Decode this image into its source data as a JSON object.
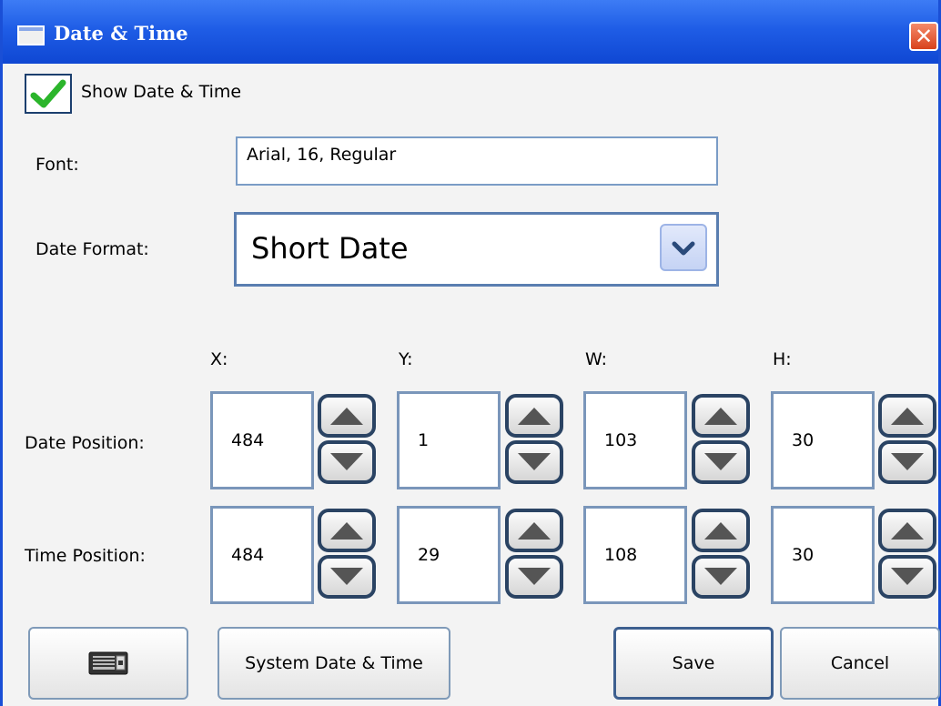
{
  "window": {
    "title": "Date & Time",
    "close_glyph": "✕"
  },
  "show_toggle": {
    "label": "Show Date & Time",
    "checked": true
  },
  "font": {
    "label": "Font:",
    "value": "Arial, 16, Regular"
  },
  "date_format": {
    "label": "Date Format:",
    "value": "Short Date"
  },
  "column_headers": {
    "x": "X:",
    "y": "Y:",
    "w": "W:",
    "h": "H:"
  },
  "date_position": {
    "label": "Date Position:",
    "x": "484",
    "y": "1",
    "w": "103",
    "h": "30"
  },
  "time_position": {
    "label": "Time Position:",
    "x": "484",
    "y": "29",
    "w": "108",
    "h": "30"
  },
  "buttons": {
    "keyboard_icon": "keyboard-icon",
    "system": "System Date & Time",
    "save": "Save",
    "cancel": "Cancel"
  },
  "colors": {
    "title_bar": "#1f5de6",
    "check": "#2bb52b",
    "window_bg": "#f3f3f3"
  }
}
